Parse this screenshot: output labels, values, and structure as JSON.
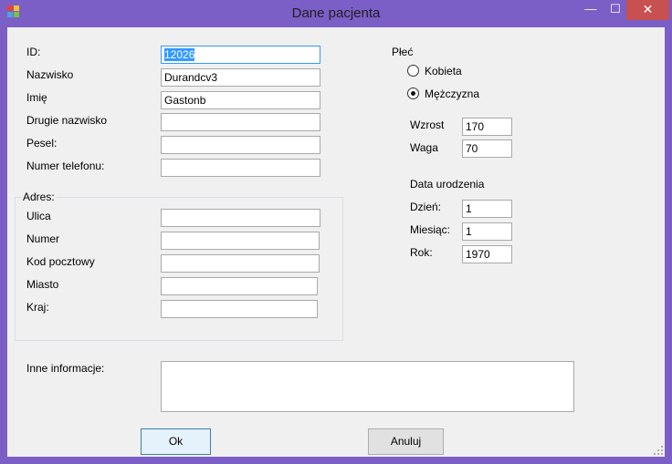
{
  "window": {
    "title": "Dane pacjenta",
    "minimize_glyph": "—",
    "maximize_glyph": "☐",
    "close_glyph": "✕"
  },
  "colors": {
    "frame": "#7b5fc7",
    "client_bg": "#f0f0f0",
    "close_button": "#c75050",
    "selection": "#3399ff"
  },
  "icons": {
    "app": "app-icon",
    "size_grip": "size-grip-icon"
  },
  "patient": {
    "id_label": "ID:",
    "id_value": "12026",
    "surname_label": "Nazwisko",
    "surname_value": "Durandcv3",
    "name_label": "Imię",
    "name_value": "Gastonb",
    "second_surname_label": "Drugie nazwisko",
    "second_surname_value": "",
    "pesel_label": "Pesel:",
    "pesel_value": "",
    "phone_label": "Numer telefonu:",
    "phone_value": ""
  },
  "address": {
    "group_label": "Adres:",
    "street_label": "Ulica",
    "street_value": "",
    "number_label": "Numer",
    "number_value": "",
    "postal_label": "Kod pocztowy",
    "postal_value": "",
    "city_label": "Miasto",
    "city_value": "",
    "country_label": "Kraj:",
    "country_value": ""
  },
  "gender": {
    "label": "Płeć",
    "options": [
      {
        "label": "Kobieta",
        "selected": false
      },
      {
        "label": "Mężczyzna",
        "selected": true
      }
    ]
  },
  "body": {
    "height_label": "Wzrost",
    "height_value": "170",
    "weight_label": "Waga",
    "weight_value": "70"
  },
  "birth": {
    "header": "Data urodzenia",
    "day_label": "Dzień:",
    "day_value": "1",
    "month_label": "Miesiąc:",
    "month_value": "1",
    "year_label": "Rok:",
    "year_value": "1970"
  },
  "other": {
    "label": "Inne informacje:",
    "value": ""
  },
  "buttons": {
    "ok": "Ok",
    "cancel": "Anuluj"
  }
}
